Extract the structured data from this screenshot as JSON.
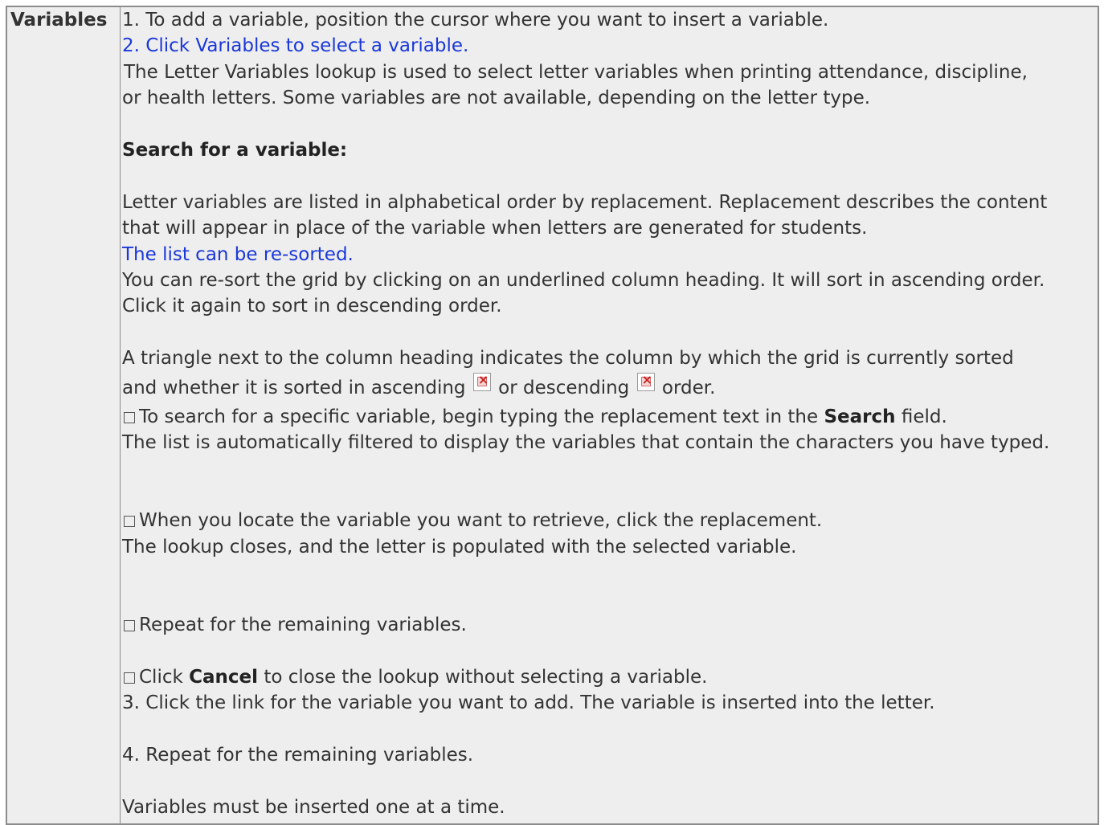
{
  "label": "Variables",
  "step1": "1. To add a variable, position the cursor where you want to insert a variable.",
  "step2_link": "2. Click Variables to select a variable.",
  "lookup_intro_1": "The Letter Variables lookup is used to select letter variables when printing attendance, discipline,",
  "lookup_intro_2": "or health letters. Some variables are not available, depending on the letter type.",
  "search_heading": "Search for a variable:",
  "list_desc_1": "Letter variables are listed in alphabetical order by replacement. Replacement describes the content",
  "list_desc_2": "that will appear in place of the variable when letters are generated for students.",
  "resort_link": "The list can be re-sorted.",
  "resort_1": "You can re-sort the grid by clicking on an underlined column heading. It will sort in ascending order.",
  "resort_2": "Click it again to sort in descending order.",
  "triangle_1": "A triangle next to the column heading indicates the column by which the grid is currently sorted",
  "triangle_2a": "and whether it is sorted in ascending",
  "triangle_2b": "or descending",
  "triangle_2c": "order.",
  "search_step_a": "To search for a specific variable, begin typing the replacement text in the",
  "search_step_bold": "Search",
  "search_step_b": "field.",
  "search_result": "The list is automatically filtered to display the variables that contain the characters you have typed.",
  "locate_step": "When you locate the variable you want to retrieve, click the replacement.",
  "locate_result": "The lookup closes, and the letter is populated with the selected variable.",
  "repeat_step": "Repeat for the remaining variables.",
  "cancel_a": "Click",
  "cancel_bold": "Cancel",
  "cancel_b": "to close the lookup without selecting a variable.",
  "step3": "3. Click the link for the variable you want to add. The variable is inserted into the letter.",
  "step4": "4. Repeat for the remaining variables.",
  "footer_note": "Variables must be inserted one at a time.",
  "icons": {
    "ascending": "broken-image-icon",
    "descending": "broken-image-icon",
    "checkbox": "checkbox-icon"
  },
  "colors": {
    "link": "#1a37d9",
    "background": "#eeeeee",
    "border": "#8c8c8c"
  }
}
